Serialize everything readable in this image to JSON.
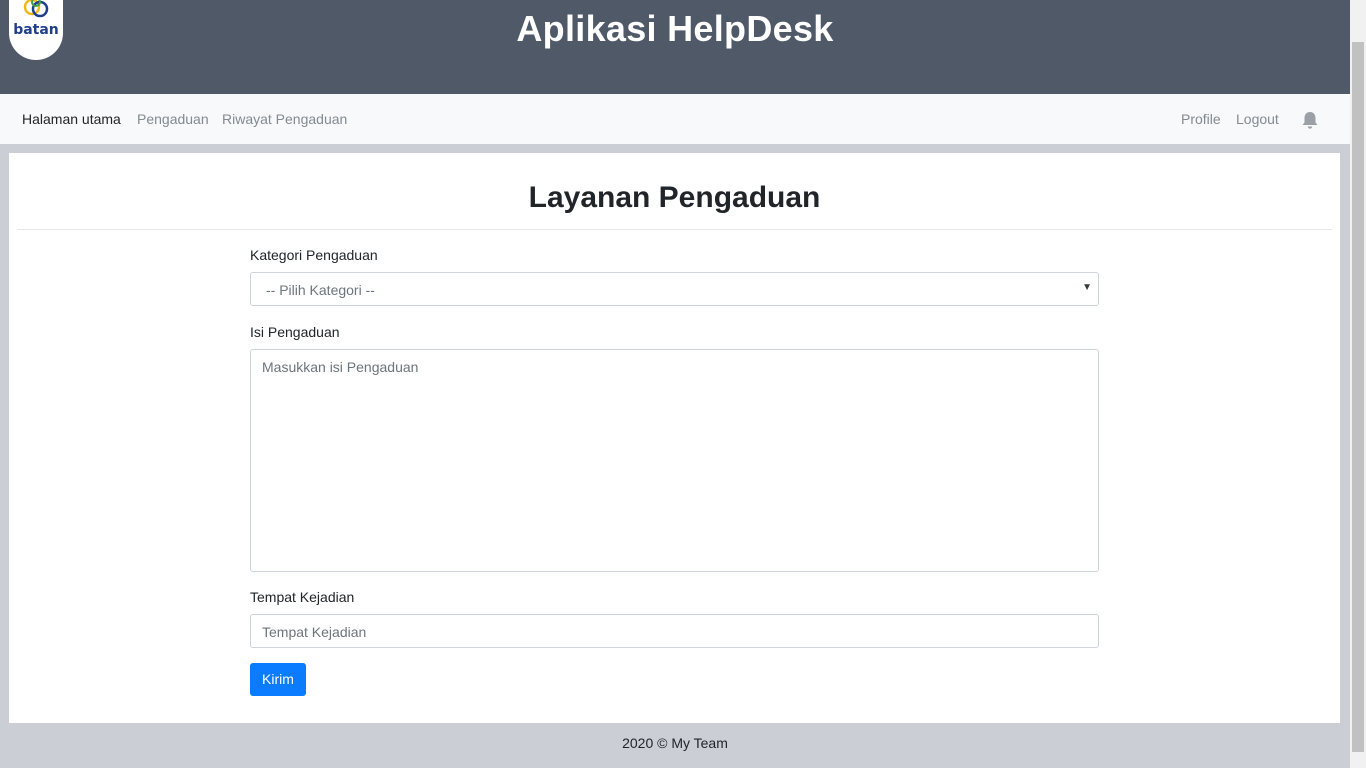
{
  "header": {
    "logo_text": "batan",
    "title": "Aplikasi HelpDesk"
  },
  "nav": {
    "left_items": [
      "Halaman utama",
      "Pengaduan",
      "Riwayat Pengaduan"
    ],
    "right_items": [
      "Profile",
      "Logout"
    ],
    "bell_icon": "bell-icon"
  },
  "form": {
    "title": "Layanan Pengaduan",
    "category_label": "Kategori Pengaduan",
    "category_selected": "-- Pilih Kategori --",
    "content_label": "Isi Pengaduan",
    "content_placeholder": "Masukkan isi Pengaduan",
    "location_label": "Tempat Kejadian",
    "location_placeholder": "Tempat Kejadian",
    "submit_label": "Kirim"
  },
  "footer": {
    "text": "2020 © My Team"
  },
  "colors": {
    "header_bg": "#4f5968",
    "navbar_bg": "#f8f9fa",
    "page_bg": "#cbced4",
    "primary": "#0b7bff"
  }
}
